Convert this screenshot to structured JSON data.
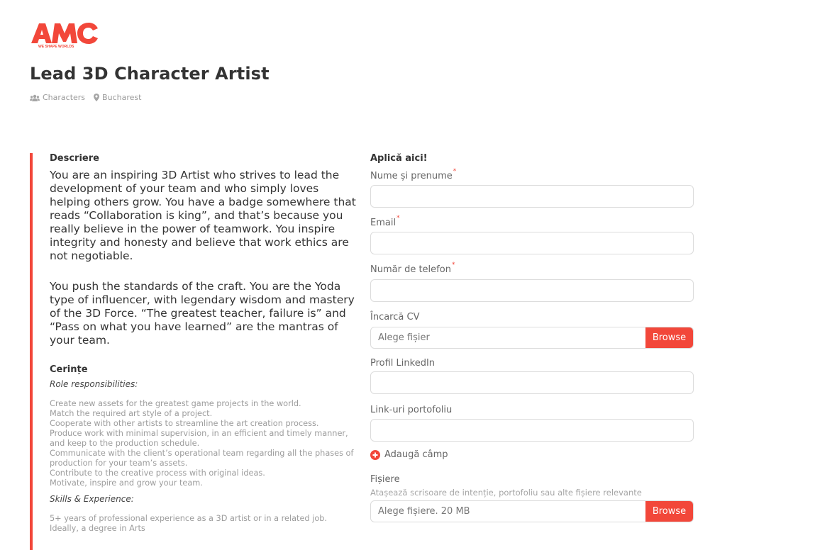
{
  "logo": {
    "text": "AMC",
    "tagline": "WE SHAPE WORLDS",
    "color": "#f2473a"
  },
  "job": {
    "title": "Lead 3D Character Artist",
    "department": "Characters",
    "location": "Bucharest"
  },
  "description": {
    "heading": "Descriere",
    "paragraphs": [
      "You are an inspiring 3D Artist who strives to lead the development of your team and who simply loves helping others grow. You have a badge somewhere that reads “Collaboration is king”, and that’s because you really believe in the power of teamwork. You inspire integrity and honesty and believe that work ethics are not negotiable.",
      "You push the standards of the craft. You are the Yoda type of influencer, with legendary wisdom and mastery of the 3D Force. “The greatest teacher, failure is” and “Pass on what you have learned” are the mantras of your team."
    ]
  },
  "requirements": {
    "heading": "Cerințe",
    "responsibilities_title": "Role responsibilities:",
    "responsibilities": "Create new assets for the greatest game projects in the world.\nMatch the required art style of a project.\nCooperate with other artists to streamline the art creation process.\nProduce work with minimal supervision, in an efficient and timely manner, and keep to the production schedule.\nCommunicate with the client’s operational team regarding all the phases of production for your team’s assets.\nContribute to the creative process with original ideas.\nMotivate, inspire and grow your team.",
    "skills_title": "Skills & Experience:",
    "skills": "5+ years of professional experience as a 3D artist or in a related job.\nIdeally, a degree in Arts"
  },
  "form": {
    "heading": "Aplică aici!",
    "required_mark": "*",
    "name_label": "Nume și prenume",
    "email_label": "Email",
    "phone_label": "Număr de telefon",
    "cv_label": "Încarcă CV",
    "cv_placeholder": "Alege fișier",
    "browse_label": "Browse",
    "linkedin_label": "Profil LinkedIn",
    "portfolio_label": "Link-uri portofoliu",
    "add_field_label": "Adaugă câmp",
    "files_label": "Fișiere",
    "files_hint": "Atașează scrisoare de intenție, portofoliu sau alte fișiere relevante",
    "files_placeholder": "Alege fișiere. 20 MB"
  },
  "colors": {
    "accent": "#f2473a"
  }
}
